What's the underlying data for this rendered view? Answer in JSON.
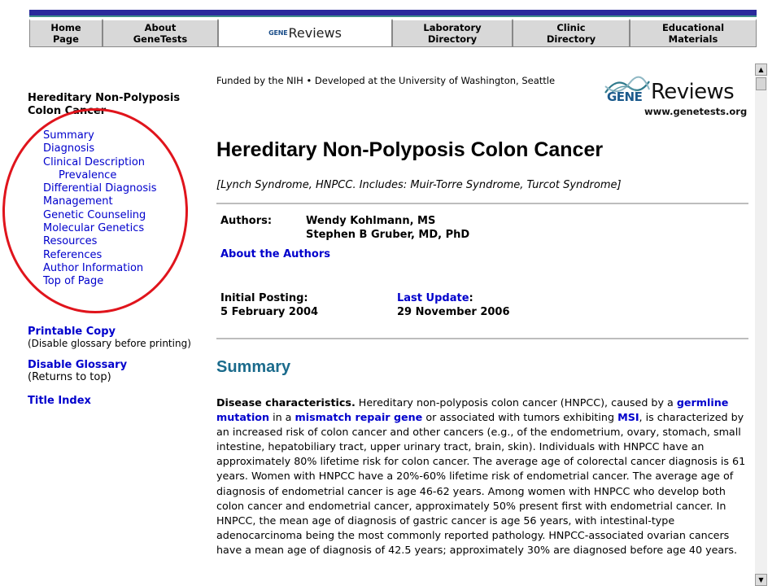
{
  "topnav": {
    "items": [
      {
        "label": "Home\nPage"
      },
      {
        "label": "About\nGeneTests"
      },
      {
        "logo_gene": "GENE",
        "logo_reviews": "Reviews"
      },
      {
        "label": "Laboratory\nDirectory"
      },
      {
        "label": "Clinic\nDirectory"
      },
      {
        "label": "Educational\nMaterials"
      }
    ]
  },
  "sidebar": {
    "title_line1": "Hereditary Non-Polyposis",
    "title_line2": "Colon Cancer",
    "toc": [
      "Summary",
      "Diagnosis",
      "Clinical Description",
      "Prevalence",
      "Differential Diagnosis",
      "Management",
      "Genetic Counseling",
      "Molecular Genetics",
      "Resources",
      "References",
      "Author Information",
      "Top of Page"
    ],
    "printable": "Printable Copy",
    "printable_note": "(Disable glossary before printing)",
    "glossary": "Disable Glossary",
    "glossary_note": "(Returns to top)",
    "title_index": "Title Index"
  },
  "header": {
    "funded": "Funded by the NIH  •  Developed at the University of Washington, Seattle",
    "logo_gene": "GENE",
    "logo_reviews": "Reviews",
    "logo_url": "www.genetests.org"
  },
  "article": {
    "title": "Hereditary Non-Polyposis Colon Cancer",
    "aliases": "[Lynch Syndrome, HNPCC. Includes: Muir-Torre Syndrome, Turcot Syndrome]",
    "authors_label": "Authors:",
    "author1": "Wendy Kohlmann, MS",
    "author2": "Stephen B Gruber, MD, PhD",
    "about_authors": "About the Authors",
    "posting_label": "Initial Posting:",
    "posting_date": "5 February 2004",
    "update_label": "Last Update",
    "update_colon": ":",
    "update_date": "29 November 2006",
    "summary_heading": "Summary",
    "para": {
      "lead": "Disease characteristics.",
      "t1": " Hereditary non-polyposis colon cancer (HNPCC), caused by a ",
      "g1": "germline mutation",
      "t2": " in a ",
      "g2": "mismatch repair gene",
      "t3": " or associated with tumors exhibiting ",
      "g3": "MSI",
      "t4": ", is characterized by an increased risk of colon cancer and other cancers (e.g., of the endometrium, ovary, stomach, small intestine, hepatobiliary tract, upper urinary tract, brain, skin). Individuals with HNPCC have an approximately 80% lifetime risk for colon cancer. The average age of colorectal cancer diagnosis is 61 years. Women with HNPCC have a 20%-60% lifetime risk of endometrial cancer. The average age of diagnosis of endometrial cancer is age 46-62 years. Among women with HNPCC who develop both colon cancer and endometrial cancer, approximately 50% present first with endometrial cancer. In HNPCC, the mean age of diagnosis of gastric cancer is age 56 years, with intestinal-type adenocarcinoma being the most commonly reported pathology. HNPCC-associated ovarian cancers have a mean age of diagnosis of 42.5 years; approximately 30% are diagnosed before age 40 years."
    }
  },
  "scrollbar": {
    "up": "▲",
    "down": "▼"
  },
  "colors": {
    "nav_stripe": "#2a2a9c",
    "annotation_circle": "#e0141c",
    "link": "#0000cc",
    "heading": "#1b6b8c"
  }
}
